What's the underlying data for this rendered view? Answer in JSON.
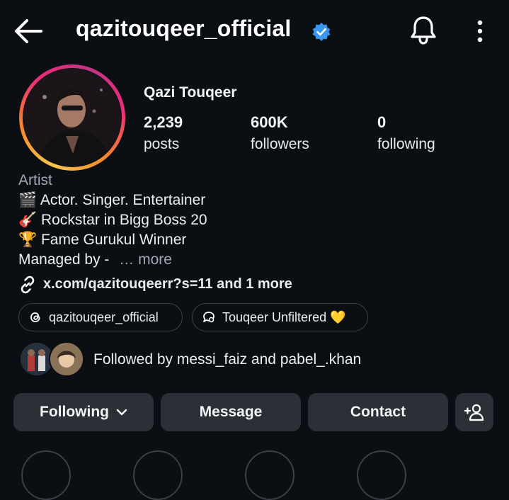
{
  "header": {
    "username": "qazitouqeer_official",
    "back_icon": "back-arrow-icon",
    "verified_icon": "verified-badge-icon",
    "notification_icon": "bell-icon",
    "menu_icon": "more-vertical-icon",
    "verified_color": "#3897f0"
  },
  "profile": {
    "full_name": "Qazi Touqeer",
    "stats": [
      {
        "value": "2,239",
        "label": "posts"
      },
      {
        "value": "600K",
        "label": "followers"
      },
      {
        "value": "0",
        "label": "following"
      }
    ],
    "category": "Artist",
    "bio": [
      "🎬 Actor. Singer. Entertainer",
      "🎸 Rockstar in Bigg Boss 20",
      "🏆 Fame Gurukul Winner"
    ],
    "managed_by": "Managed by - ",
    "more_label": "… more",
    "link": "x.com/qazitouqeerr?s=11 and 1 more",
    "link_icon": "link-icon"
  },
  "chips": [
    {
      "label": "qazitouqeer_official",
      "icon": "threads-icon"
    },
    {
      "label": "Touqeer Unfiltered 💛",
      "icon": "channel-icon"
    }
  ],
  "followed_by": "Followed by messi_faiz and pabel_.khan",
  "actions": {
    "following": "Following",
    "message": "Message",
    "contact": "Contact",
    "add_person_icon": "add-person-icon"
  },
  "colors": {
    "background": "#0b0f14",
    "button_bg": "#2b3036",
    "muted_text": "#a2a8b1"
  }
}
